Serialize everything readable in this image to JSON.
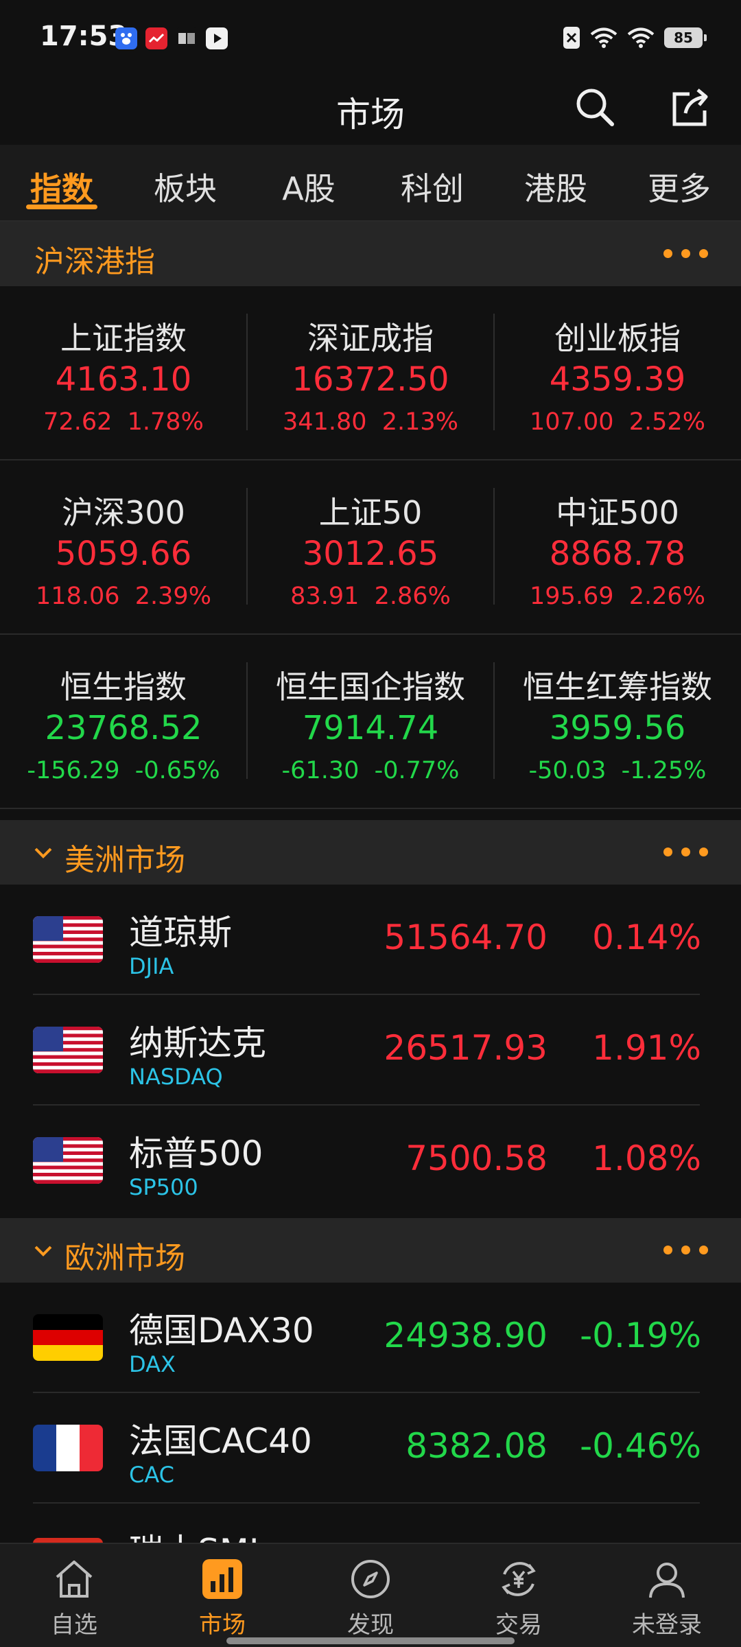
{
  "status": {
    "time": "17:53",
    "battery": "85",
    "app_icons": [
      "baidu-icon",
      "stock-app-icon",
      "reader-icon",
      "play-icon"
    ]
  },
  "header": {
    "title": "市场"
  },
  "tabs": [
    "指数",
    "板块",
    "A股",
    "科创",
    "港股",
    "更多"
  ],
  "sections": {
    "hs": {
      "title": "沪深港指"
    },
    "americas": {
      "title": "美洲市场"
    },
    "europe": {
      "title": "欧洲市场"
    }
  },
  "indices": [
    {
      "name": "上证指数",
      "value": "4163.10",
      "change": "72.62",
      "pct": "1.78%",
      "dir": "up"
    },
    {
      "name": "深证成指",
      "value": "16372.50",
      "change": "341.80",
      "pct": "2.13%",
      "dir": "up"
    },
    {
      "name": "创业板指",
      "value": "4359.39",
      "change": "107.00",
      "pct": "2.52%",
      "dir": "up"
    },
    {
      "name": "沪深300",
      "value": "5059.66",
      "change": "118.06",
      "pct": "2.39%",
      "dir": "up"
    },
    {
      "name": "上证50",
      "value": "3012.65",
      "change": "83.91",
      "pct": "2.86%",
      "dir": "up"
    },
    {
      "name": "中证500",
      "value": "8868.78",
      "change": "195.69",
      "pct": "2.26%",
      "dir": "up"
    },
    {
      "name": "恒生指数",
      "value": "23768.52",
      "change": "-156.29",
      "pct": "-0.65%",
      "dir": "down"
    },
    {
      "name": "恒生国企指数",
      "value": "7914.74",
      "change": "-61.30",
      "pct": "-0.77%",
      "dir": "down"
    },
    {
      "name": "恒生红筹指数",
      "value": "3959.56",
      "change": "-50.03",
      "pct": "-1.25%",
      "dir": "down"
    }
  ],
  "americas": [
    {
      "name": "道琼斯",
      "code": "DJIA",
      "price": "51564.70",
      "pct": "0.14%",
      "dir": "up",
      "flag": "us-flag-icon"
    },
    {
      "name": "纳斯达克",
      "code": "NASDAQ",
      "price": "26517.93",
      "pct": "1.91%",
      "dir": "up",
      "flag": "us-flag-icon"
    },
    {
      "name": "标普500",
      "code": "SP500",
      "price": "7500.58",
      "pct": "1.08%",
      "dir": "up",
      "flag": "us-flag-icon"
    }
  ],
  "europe": [
    {
      "name": "德国DAX30",
      "code": "DAX",
      "price": "24938.90",
      "pct": "-0.19%",
      "dir": "down",
      "flag": "germany-flag-icon"
    },
    {
      "name": "法国CAC40",
      "code": "CAC",
      "price": "8382.08",
      "pct": "-0.46%",
      "dir": "down",
      "flag": "france-flag-icon"
    },
    {
      "name": "瑞士SMI",
      "code": "",
      "price": "",
      "pct": "",
      "dir": "down",
      "flag": "switzerland-flag-icon"
    }
  ],
  "nav": [
    {
      "label": "自选",
      "icon": "home-icon"
    },
    {
      "label": "市场",
      "icon": "market-chart-icon"
    },
    {
      "label": "发现",
      "icon": "compass-icon"
    },
    {
      "label": "交易",
      "icon": "yuan-exchange-icon"
    },
    {
      "label": "未登录",
      "icon": "user-icon"
    }
  ],
  "colors": {
    "accent": "#ff9a1f",
    "up": "#ff2d3a",
    "down": "#22d84a",
    "code": "#2cc3e6"
  }
}
